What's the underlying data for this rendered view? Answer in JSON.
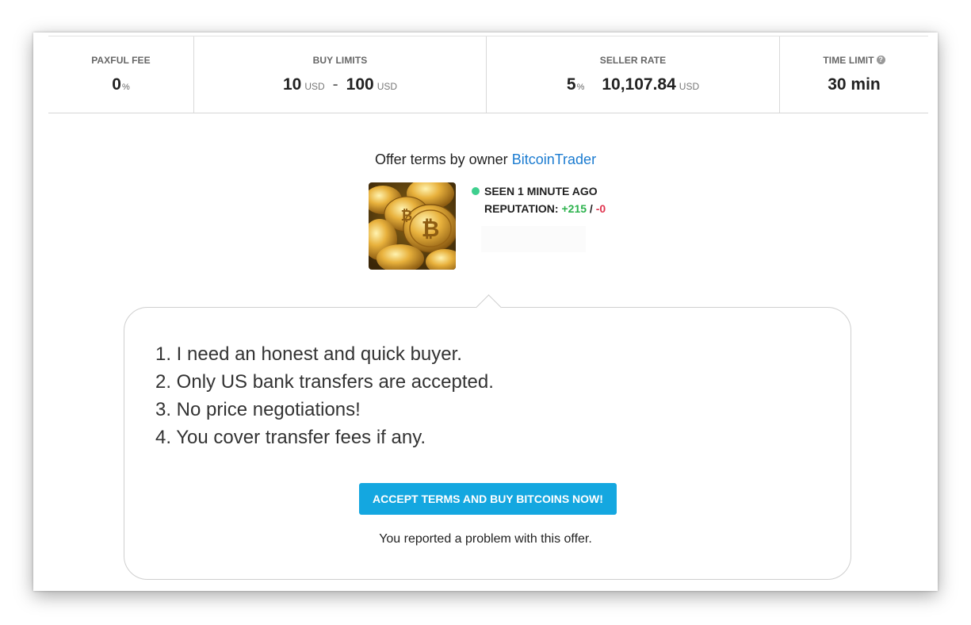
{
  "stats": [
    {
      "label": "PAXFUL FEE",
      "value": "0",
      "suffix": "%"
    },
    {
      "label": "BUY LIMITS",
      "min": "10",
      "min_unit": "USD",
      "separator": "-",
      "max": "100",
      "max_unit": "USD"
    },
    {
      "label": "SELLER RATE",
      "percent": "5",
      "percent_suffix": "%",
      "rate": "10,107.84",
      "rate_unit": "USD"
    },
    {
      "label": "TIME LIMIT",
      "value": "30 min",
      "help_icon": "question-circle-icon"
    }
  ],
  "owner": {
    "prefix": "Offer terms by owner",
    "name": "BitcoinTrader",
    "seen": "SEEN 1 MINUTE AGO",
    "reputation_label": "REPUTATION:",
    "reputation_positive": "+215",
    "reputation_separator": "/",
    "reputation_negative": "-0",
    "status_color": "#3ecf8e"
  },
  "terms": [
    "1. I need an honest and quick buyer.",
    "2. Only US bank transfers are accepted.",
    "3. No price negotiations!",
    "4. You cover transfer fees if any."
  ],
  "accept_button": "ACCEPT TERMS AND BUY BITCOINS NOW!",
  "report_message": "You reported a problem with this offer.",
  "colors": {
    "accent": "#14a7e0",
    "link": "#1a7bd0",
    "positive": "#2bb24c",
    "negative": "#e0344f"
  }
}
